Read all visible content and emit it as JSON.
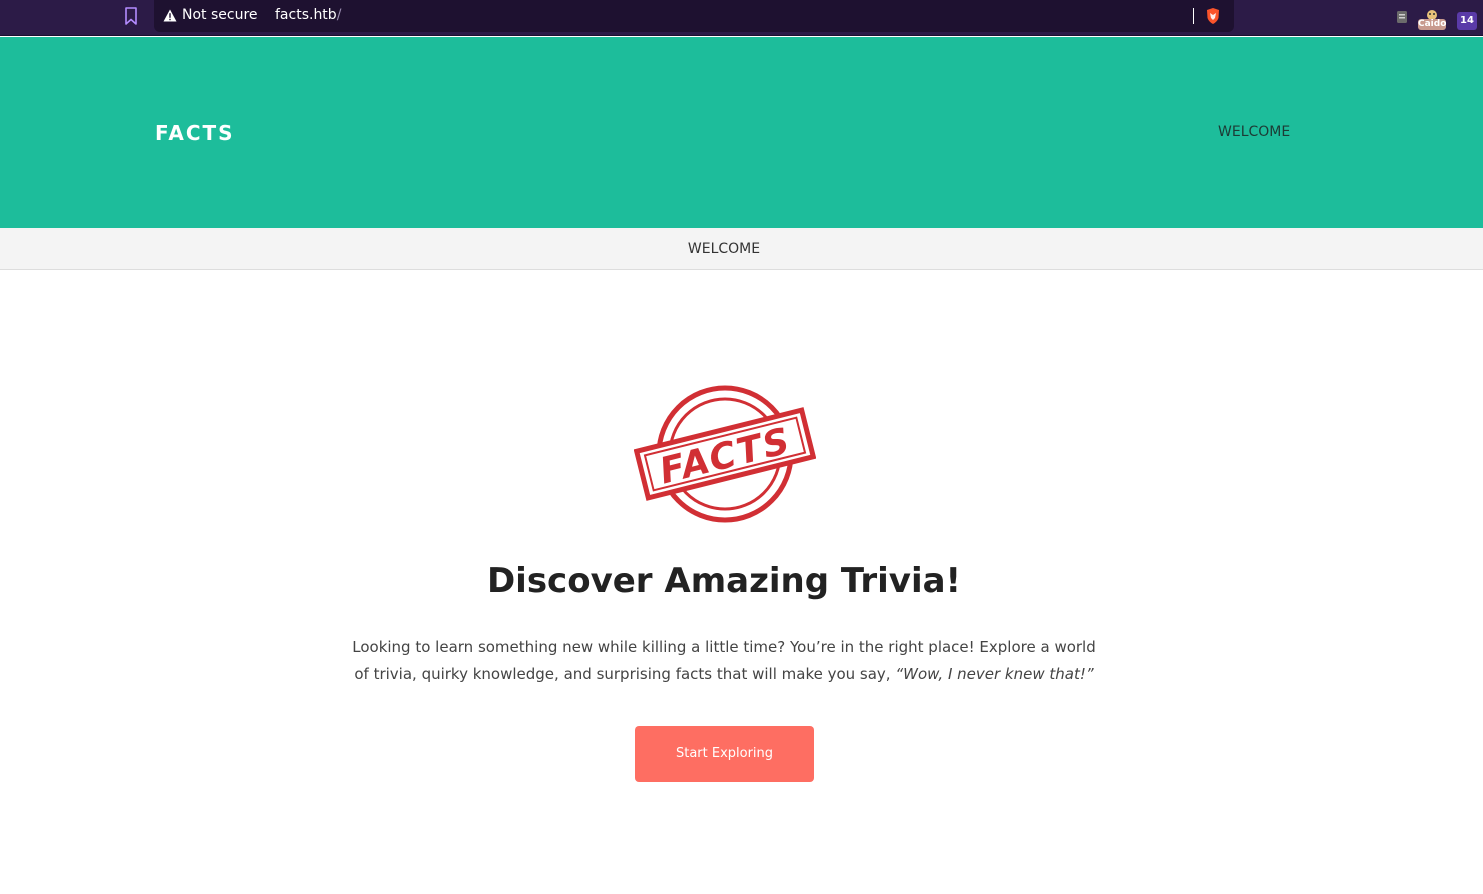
{
  "browser": {
    "security_label": "Not secure",
    "url_host": "facts.htb",
    "url_path": "/",
    "extension_caido_label": "Caido",
    "extension_badge_count": "14",
    "colors": {
      "bar": "#2c1b47",
      "urlbar": "#1e1130"
    }
  },
  "header": {
    "brand": "FACTS",
    "nav_item": "WELCOME",
    "background": "#1dbd9b"
  },
  "subnav": {
    "item": "WELCOME"
  },
  "hero": {
    "logo_text": "FACTS",
    "title": "Discover Amazing Trivia!",
    "description": "Looking to learn something new while killing a little time? You’re in the right place! Explore a world of trivia, quirky knowledge, and surprising facts that will make you say, ",
    "quote": "“Wow, I never knew that!”",
    "cta_label": "Start Exploring",
    "cta_color": "#fe6e62",
    "stamp_color": "#d12f34"
  }
}
